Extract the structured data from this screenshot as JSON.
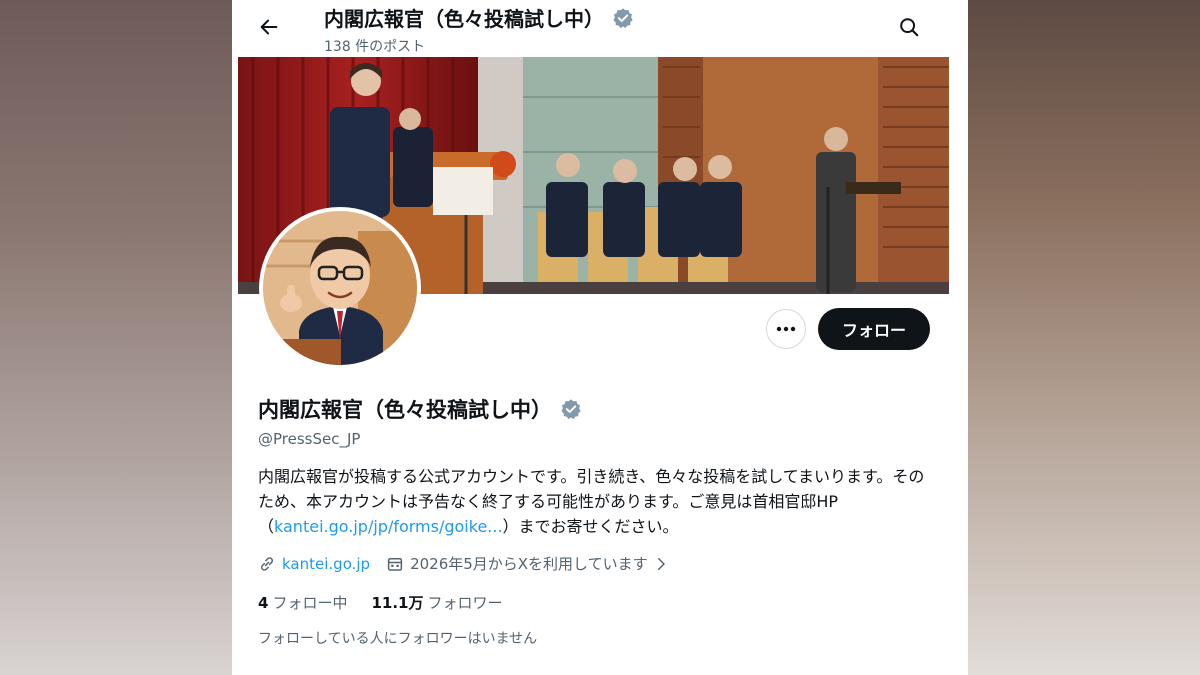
{
  "header": {
    "title": "内閣広報官（色々投稿試し中）",
    "post_count": "138 件のポスト"
  },
  "profile": {
    "name": "内閣広報官（色々投稿試し中）",
    "handle": "@PressSec_JP",
    "bio_text": "内閣広報官が投稿する公式アカウントです。引き続き、色々な投稿を試してまいります。そのため、本アカウントは予告なく終了する可能性があります。ご意見は首相官邸HP（",
    "bio_link": "kantei.go.jp/jp/forms/goike...",
    "bio_tail": "）までお寄せください。",
    "website": "kantei.go.jp",
    "joined": "2026年5月からXを利用しています",
    "following_count": "4",
    "following_label": "フォロー中",
    "followers_count": "11.1万",
    "followers_label": "フォロワー",
    "followers_note": "フォローしている人にフォロワーはいません"
  },
  "actions": {
    "follow_label": "フォロー"
  },
  "colors": {
    "text_primary": "#0f1419",
    "text_secondary": "#536471",
    "link": "#1d9bf0",
    "verified_badge": "#829aab"
  }
}
